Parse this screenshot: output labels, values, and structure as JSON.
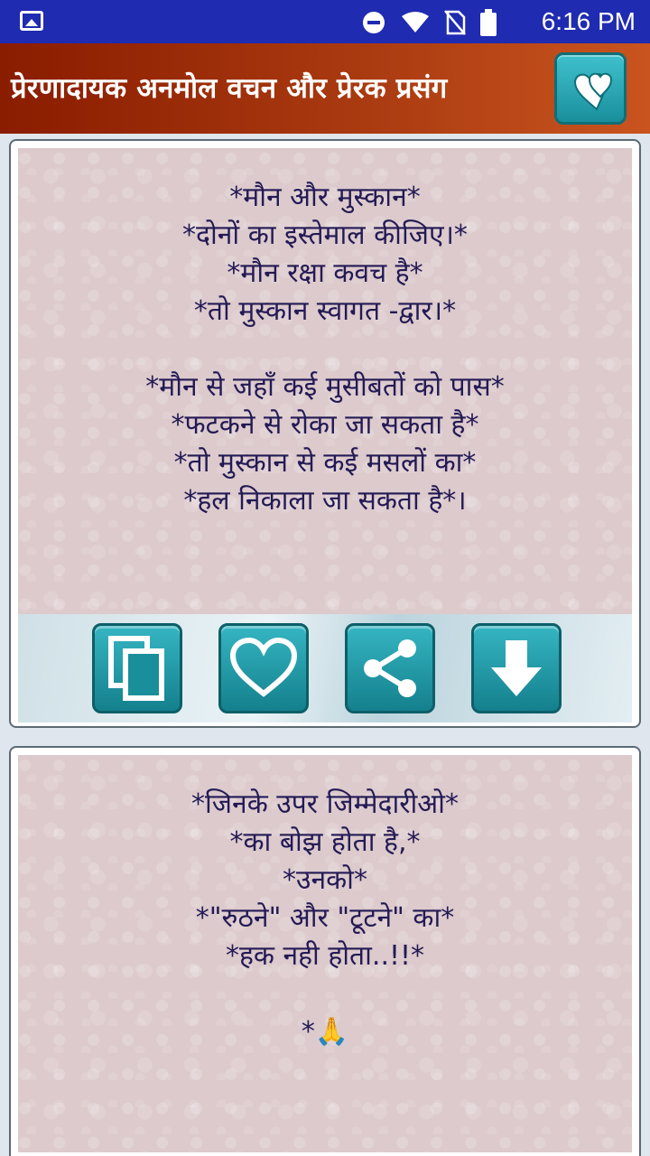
{
  "status": {
    "time": "6:16 PM",
    "icons": [
      "image-icon",
      "dnd-icon",
      "wifi-icon",
      "no-sim-icon",
      "battery-icon"
    ]
  },
  "appbar": {
    "title": "प्रेरणादायक अनमोल वचन और प्रेरक प्रसंग",
    "fav_icon": "hearts-icon"
  },
  "quotes": [
    {
      "text": "*मौन और मुस्कान*\n*दोनों का इस्तेमाल कीजिए।*\n*मौन रक्षा कवच है*\n*तो मुस्कान स्वागत -द्वार।*\n\n*मौन से जहाँ कई मुसीबतों को पास*\n*फटकने से रोका जा सकता है*\n*तो मुस्कान से कई मसलों का*\n*हल निकाला जा सकता है*।"
    },
    {
      "text": "*जिनके उपर जिम्मेदारीओ*\n*का बोझ होता है,*\n*उनको*\n*\"रुठने\" और \"टूटने\" का*\n*हक नही होता..!!*\n\n  *🙏"
    }
  ],
  "actions": [
    "copy-icon",
    "heart-icon",
    "share-icon",
    "download-icon"
  ],
  "colors": {
    "status_bar": "#1f2bb0",
    "app_bar": "#8a1c00",
    "button": "#1a8f9c",
    "quote_text": "#231a55"
  }
}
